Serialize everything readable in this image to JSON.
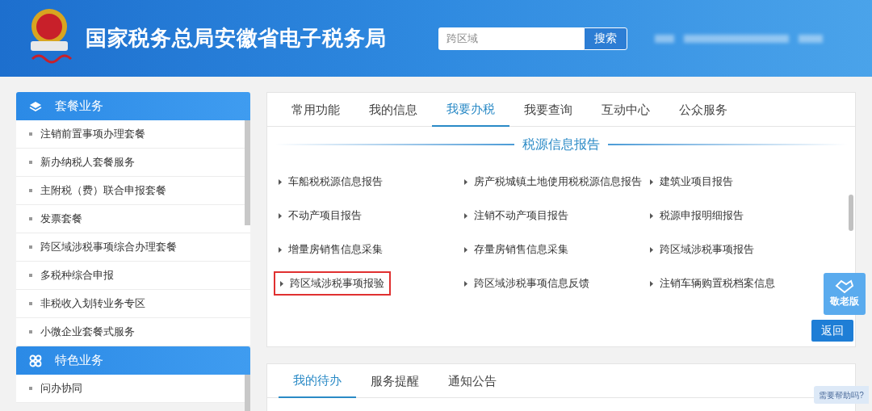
{
  "header": {
    "title": "国家税务总局安徽省电子税务局",
    "search": {
      "placeholder": "跨区域"
    },
    "search_button": "搜索"
  },
  "sidebar": {
    "sections": [
      {
        "title": "套餐业务",
        "items": [
          "注销前置事项办理套餐",
          "新办纳税人套餐服务",
          "主附税（费）联合申报套餐",
          "发票套餐",
          "跨区域涉税事项综合办理套餐",
          "多税种综合申报",
          "非税收入划转业务专区",
          "小微企业套餐式服务"
        ]
      },
      {
        "title": "特色业务",
        "items": [
          "问办协同"
        ]
      }
    ]
  },
  "main_tabs": [
    {
      "label": "常用功能",
      "selected": false
    },
    {
      "label": "我的信息",
      "selected": false
    },
    {
      "label": "我要办税",
      "selected": true
    },
    {
      "label": "我要查询",
      "selected": false
    },
    {
      "label": "互动中心",
      "selected": false
    },
    {
      "label": "公众服务",
      "selected": false
    }
  ],
  "section_title": "税源信息报告",
  "items": [
    {
      "label": "车船税税源信息报告",
      "highlighted": false
    },
    {
      "label": "房产税城镇土地使用税税源信息报告",
      "highlighted": false
    },
    {
      "label": "建筑业项目报告",
      "highlighted": false
    },
    {
      "label": "不动产项目报告",
      "highlighted": false
    },
    {
      "label": "注销不动产项目报告",
      "highlighted": false
    },
    {
      "label": "税源申报明细报告",
      "highlighted": false
    },
    {
      "label": "增量房销售信息采集",
      "highlighted": false
    },
    {
      "label": "存量房销售信息采集",
      "highlighted": false
    },
    {
      "label": "跨区域涉税事项报告",
      "highlighted": false
    },
    {
      "label": "跨区域涉税事项报验",
      "highlighted": true
    },
    {
      "label": "跨区域涉税事项信息反馈",
      "highlighted": false
    },
    {
      "label": "注销车辆购置税档案信息",
      "highlighted": false
    }
  ],
  "back_button": "返回",
  "elder_button": "敬老版",
  "bottom_tabs": [
    {
      "label": "我的待办",
      "selected": true
    },
    {
      "label": "服务提醒",
      "selected": false
    },
    {
      "label": "通知公告",
      "selected": false
    }
  ],
  "help_bubble": "需要帮助吗?"
}
